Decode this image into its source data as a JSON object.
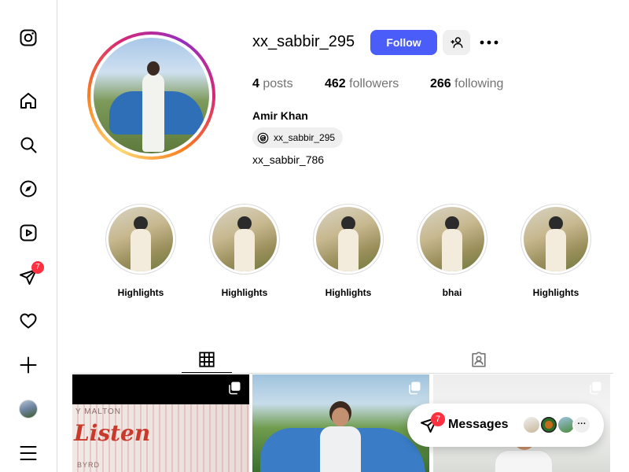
{
  "nav": {
    "items": [
      {
        "name": "instagram-logo",
        "icon": "instagram-icon"
      },
      {
        "name": "home",
        "icon": "home-icon"
      },
      {
        "name": "search",
        "icon": "search-icon"
      },
      {
        "name": "explore",
        "icon": "compass-icon"
      },
      {
        "name": "reels",
        "icon": "reels-icon"
      },
      {
        "name": "messages",
        "icon": "paper-plane-icon",
        "badge": "7"
      },
      {
        "name": "notifications",
        "icon": "heart-icon"
      },
      {
        "name": "create",
        "icon": "plus-icon"
      },
      {
        "name": "profile",
        "icon": "avatar"
      },
      {
        "name": "more",
        "icon": "menu-icon"
      }
    ],
    "messages_badge": "7"
  },
  "profile": {
    "username": "xx_sabbir_295",
    "follow_label": "Follow",
    "stats": {
      "posts_count": "4",
      "posts_label": "posts",
      "followers_count": "462",
      "followers_label": "followers",
      "following_count": "266",
      "following_label": "following"
    },
    "full_name": "Amir Khan",
    "threads_handle": "xx_sabbir_295",
    "bio": "xx_sabbir_786"
  },
  "highlights": [
    {
      "label": "Highlights"
    },
    {
      "label": "Highlights"
    },
    {
      "label": "Highlights"
    },
    {
      "label": "bhai"
    },
    {
      "label": "Highlights"
    }
  ],
  "tabs": [
    {
      "name": "posts",
      "icon": "grid-icon",
      "active": true
    },
    {
      "name": "tagged",
      "icon": "tagged-user-icon",
      "active": false
    }
  ],
  "posts": [
    {
      "type": "carousel",
      "poster_title": "Listen",
      "poster_top": "Y MALTON",
      "poster_bottom": "BYRD"
    },
    {
      "type": "carousel"
    },
    {
      "type": "carousel"
    }
  ],
  "messages_bar": {
    "label": "Messages",
    "badge": "7",
    "more": "···"
  },
  "colors": {
    "accent": "#4a5df9",
    "badge": "#ff3040",
    "border": "#dbdbdb",
    "muted_text": "#737373"
  }
}
